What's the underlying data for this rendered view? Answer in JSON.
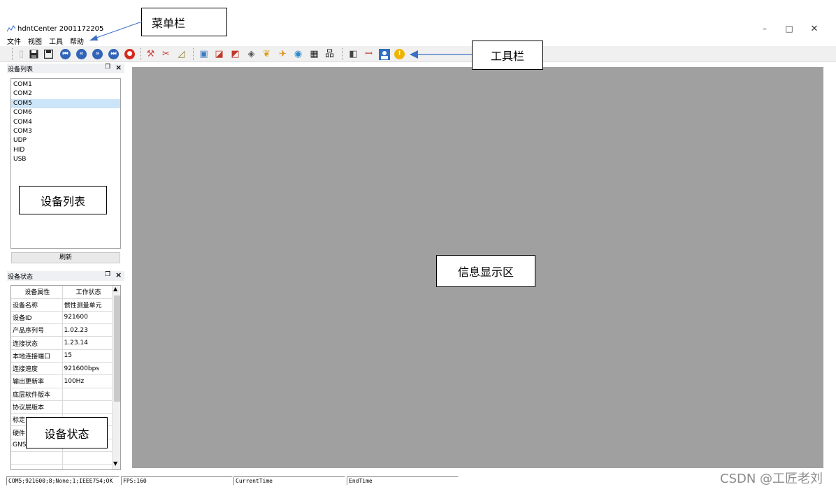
{
  "window": {
    "title": "hdntCenter 2001172205",
    "minimize_glyph": "–",
    "maximize_glyph": "□",
    "close_glyph": "✕"
  },
  "menu": {
    "items": [
      "文件",
      "视图",
      "工具",
      "帮助"
    ]
  },
  "toolbar": {
    "icons": [
      "new-file-icon",
      "save-icon",
      "save-as-icon",
      "first-icon",
      "rewind-icon",
      "forward-icon",
      "last-icon",
      "stop-icon",
      "connect-icon",
      "tools-icon",
      "calibrate-icon",
      "capture-icon",
      "chart-line-icon",
      "chart-area-icon",
      "cube-icon",
      "people-icon",
      "plane-icon",
      "globe-icon",
      "table-icon",
      "network-icon",
      "window-icon",
      "signal-icon",
      "user-icon",
      "info-icon"
    ]
  },
  "device_list_panel": {
    "title": "设备列表",
    "pin_glyph": "❐",
    "close_glyph": "×",
    "items": [
      "COM1",
      "COM2",
      "COM5",
      "COM6",
      "COM4",
      "COM3",
      "UDP",
      "HID",
      "USB"
    ],
    "selected": "COM5",
    "refresh_label": "刷新"
  },
  "device_status_panel": {
    "title": "设备状态",
    "pin_glyph": "❐",
    "close_glyph": "×",
    "headers": [
      "设备属性",
      "工作状态"
    ],
    "rows": [
      [
        "设备名称",
        "惯性测量单元"
      ],
      [
        "设备ID",
        "921600"
      ],
      [
        "产品序列号",
        "1.02.23"
      ],
      [
        "连接状态",
        "1.23.14"
      ],
      [
        "本地连接端口",
        "15"
      ],
      [
        "连接速度",
        "921600bps"
      ],
      [
        "输出更新率",
        "100Hz"
      ],
      [
        "底层软件版本",
        ""
      ],
      [
        "协议层版本",
        ""
      ],
      [
        "标定",
        ""
      ],
      [
        "硬件",
        ""
      ],
      [
        "GNSS",
        ""
      ],
      [
        "",
        ""
      ],
      [
        "",
        ""
      ]
    ]
  },
  "annotations": {
    "menu_bar": "菜单栏",
    "toolbar": "工具栏",
    "device_list": "设备列表",
    "info_area": "信息显示区",
    "device_status": "设备状态"
  },
  "status_bar": {
    "port_info": "COM5;921600;8;None;1;IEEE754;OK",
    "fps": "FPS:160",
    "current_time": "CurrentTime",
    "end_time": "EndTime"
  },
  "watermark": "CSDN @工匠老刘",
  "colors": {
    "main_area": "#a0a0a0",
    "selection": "#cce4f7",
    "arrow": "#3b6fc4"
  }
}
